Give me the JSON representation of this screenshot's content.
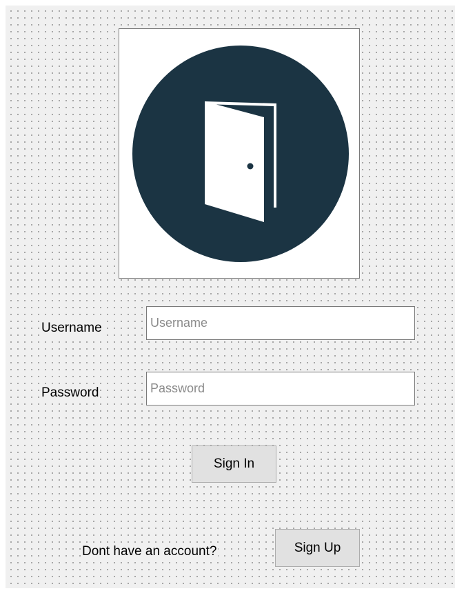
{
  "logo": {
    "icon": "open-door-icon",
    "circle_color": "#1b3443",
    "door_color": "#ffffff"
  },
  "form": {
    "username_label": "Username",
    "username_placeholder": "Username",
    "password_label": "Password",
    "password_placeholder": "Password",
    "sign_in_label": "Sign In",
    "no_account_text": "Dont have an account?",
    "sign_up_label": "Sign Up"
  },
  "colors": {
    "form_background": "#f0f0f0",
    "button_background": "#e1e1e1",
    "field_border": "#7a7a7a"
  }
}
